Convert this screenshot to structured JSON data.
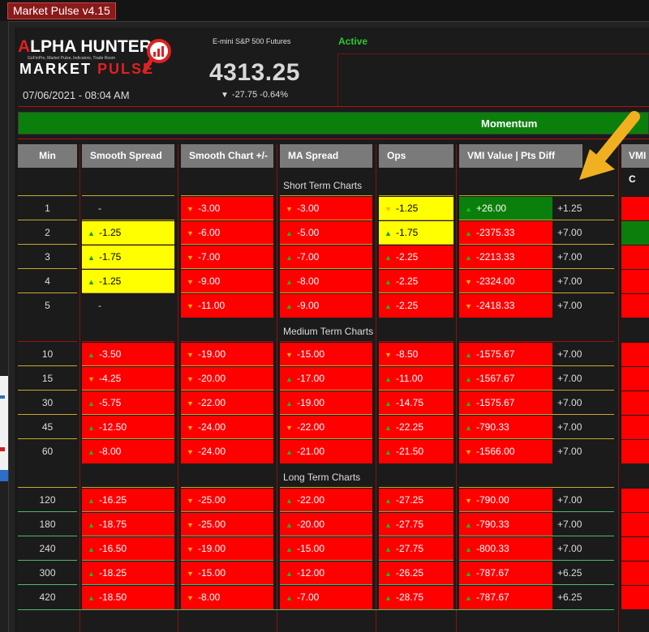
{
  "app": {
    "title": "Market Pulse v4.15"
  },
  "logo": {
    "line1_prefix": "LPHA HUNTERS",
    "line1_initial": "A",
    "tagline": "GoFinPro, Market Pulse, Indicators, Trade Room",
    "line2a": "MARKET ",
    "line2b": "PULSE",
    "icon": "magnifier-chart-icon"
  },
  "header": {
    "datetime": "07/06/2021 - 08:04 AM",
    "instrument": "E-mini S&P 500 Futures",
    "price": "4313.25",
    "change": "-27.75 -0.64%",
    "change_icon": "down-triangle-icon",
    "status": "Active"
  },
  "momentum_label": "Momentum",
  "columns": {
    "min": "Min",
    "smooth_spread": "Smooth Spread",
    "smooth_chart": "Smooth Chart +/-",
    "ma_spread": "MA Spread",
    "ops": "Ops",
    "vmi": "VMI Value | Pts Diff",
    "vmi2": "VMI C"
  },
  "sections": {
    "short": "Short Term Charts",
    "medium": "Medium Term Charts",
    "long": "Long Term Charts"
  },
  "colors": {
    "red": "#ff0000",
    "yellow": "#ffff00",
    "green": "#0b7f0b",
    "arrow": "#f0b020"
  },
  "rows": [
    {
      "min": "1",
      "ss": {
        "v": "-",
        "bg": "plain",
        "arr": ""
      },
      "sc": {
        "v": "-3.00",
        "bg": "red",
        "arr": "down"
      },
      "ma": {
        "v": "-3.00",
        "bg": "red",
        "arr": "down"
      },
      "ops": {
        "v": "-1.25",
        "bg": "yellow",
        "arr": "down"
      },
      "vmi": {
        "v": "+26.00",
        "bg": "green",
        "arr": "up"
      },
      "diff": "+1.25",
      "vmi2": "red"
    },
    {
      "min": "2",
      "ss": {
        "v": "-1.25",
        "bg": "yellow",
        "arr": "up"
      },
      "sc": {
        "v": "-6.00",
        "bg": "red",
        "arr": "down"
      },
      "ma": {
        "v": "-5.00",
        "bg": "red",
        "arr": "up"
      },
      "ops": {
        "v": "-1.75",
        "bg": "yellow",
        "arr": "up"
      },
      "vmi": {
        "v": "-2375.33",
        "bg": "red",
        "arr": "up"
      },
      "diff": "+7.00",
      "vmi2": "green"
    },
    {
      "min": "3",
      "ss": {
        "v": "-1.75",
        "bg": "yellow",
        "arr": "up"
      },
      "sc": {
        "v": "-7.00",
        "bg": "red",
        "arr": "down"
      },
      "ma": {
        "v": "-7.00",
        "bg": "red",
        "arr": "up"
      },
      "ops": {
        "v": "-2.25",
        "bg": "red",
        "arr": "up"
      },
      "vmi": {
        "v": "-2213.33",
        "bg": "red",
        "arr": "up"
      },
      "diff": "+7.00",
      "vmi2": "red"
    },
    {
      "min": "4",
      "ss": {
        "v": "-1.25",
        "bg": "yellow",
        "arr": "up"
      },
      "sc": {
        "v": "-9.00",
        "bg": "red",
        "arr": "down"
      },
      "ma": {
        "v": "-8.00",
        "bg": "red",
        "arr": "up"
      },
      "ops": {
        "v": "-2.25",
        "bg": "red",
        "arr": "up"
      },
      "vmi": {
        "v": "-2324.00",
        "bg": "red",
        "arr": "down"
      },
      "diff": "+7.00",
      "vmi2": "red"
    },
    {
      "min": "5",
      "ss": {
        "v": "-",
        "bg": "plain",
        "arr": ""
      },
      "sc": {
        "v": "-11.00",
        "bg": "red",
        "arr": "down"
      },
      "ma": {
        "v": "-9.00",
        "bg": "red",
        "arr": "up"
      },
      "ops": {
        "v": "-2.25",
        "bg": "red",
        "arr": "up"
      },
      "vmi": {
        "v": "-2418.33",
        "bg": "red",
        "arr": "down"
      },
      "diff": "+7.00",
      "vmi2": "red"
    },
    {
      "min": "10",
      "ss": {
        "v": "-3.50",
        "bg": "red",
        "arr": "up"
      },
      "sc": {
        "v": "-19.00",
        "bg": "red",
        "arr": "down"
      },
      "ma": {
        "v": "-15.00",
        "bg": "red",
        "arr": "down"
      },
      "ops": {
        "v": "-8.50",
        "bg": "red",
        "arr": "down"
      },
      "vmi": {
        "v": "-1575.67",
        "bg": "red",
        "arr": "up"
      },
      "diff": "+7.00",
      "vmi2": "red"
    },
    {
      "min": "15",
      "ss": {
        "v": "-4.25",
        "bg": "red",
        "arr": "down"
      },
      "sc": {
        "v": "-20.00",
        "bg": "red",
        "arr": "down"
      },
      "ma": {
        "v": "-17.00",
        "bg": "red",
        "arr": "up"
      },
      "ops": {
        "v": "-11.00",
        "bg": "red",
        "arr": "up"
      },
      "vmi": {
        "v": "-1567.67",
        "bg": "red",
        "arr": "up"
      },
      "diff": "+7.00",
      "vmi2": "red"
    },
    {
      "min": "30",
      "ss": {
        "v": "-5.75",
        "bg": "red",
        "arr": "up"
      },
      "sc": {
        "v": "-22.00",
        "bg": "red",
        "arr": "down"
      },
      "ma": {
        "v": "-19.00",
        "bg": "red",
        "arr": "up"
      },
      "ops": {
        "v": "-14.75",
        "bg": "red",
        "arr": "up"
      },
      "vmi": {
        "v": "-1575.67",
        "bg": "red",
        "arr": "up"
      },
      "diff": "+7.00",
      "vmi2": "red"
    },
    {
      "min": "45",
      "ss": {
        "v": "-12.50",
        "bg": "red",
        "arr": "up"
      },
      "sc": {
        "v": "-24.00",
        "bg": "red",
        "arr": "down"
      },
      "ma": {
        "v": "-22.00",
        "bg": "red",
        "arr": "down"
      },
      "ops": {
        "v": "-22.25",
        "bg": "red",
        "arr": "up"
      },
      "vmi": {
        "v": "-790.33",
        "bg": "red",
        "arr": "up"
      },
      "diff": "+7.00",
      "vmi2": "red"
    },
    {
      "min": "60",
      "ss": {
        "v": "-8.00",
        "bg": "red",
        "arr": "up"
      },
      "sc": {
        "v": "-24.00",
        "bg": "red",
        "arr": "down"
      },
      "ma": {
        "v": "-21.00",
        "bg": "red",
        "arr": "up"
      },
      "ops": {
        "v": "-21.50",
        "bg": "red",
        "arr": "up"
      },
      "vmi": {
        "v": "-1566.00",
        "bg": "red",
        "arr": "down"
      },
      "diff": "+7.00",
      "vmi2": "red"
    },
    {
      "min": "120",
      "ss": {
        "v": "-16.25",
        "bg": "red",
        "arr": "up"
      },
      "sc": {
        "v": "-25.00",
        "bg": "red",
        "arr": "down"
      },
      "ma": {
        "v": "-22.00",
        "bg": "red",
        "arr": "up"
      },
      "ops": {
        "v": "-27.25",
        "bg": "red",
        "arr": "up"
      },
      "vmi": {
        "v": "-790.00",
        "bg": "red",
        "arr": "down"
      },
      "diff": "+7.00",
      "vmi2": "red"
    },
    {
      "min": "180",
      "ss": {
        "v": "-18.75",
        "bg": "red",
        "arr": "up"
      },
      "sc": {
        "v": "-25.00",
        "bg": "red",
        "arr": "down"
      },
      "ma": {
        "v": "-20.00",
        "bg": "red",
        "arr": "up"
      },
      "ops": {
        "v": "-27.75",
        "bg": "red",
        "arr": "up"
      },
      "vmi": {
        "v": "-790.33",
        "bg": "red",
        "arr": "up"
      },
      "diff": "+7.00",
      "vmi2": "red"
    },
    {
      "min": "240",
      "ss": {
        "v": "-16.50",
        "bg": "red",
        "arr": "up"
      },
      "sc": {
        "v": "-19.00",
        "bg": "red",
        "arr": "down"
      },
      "ma": {
        "v": "-15.00",
        "bg": "red",
        "arr": "up"
      },
      "ops": {
        "v": "-27.75",
        "bg": "red",
        "arr": "up"
      },
      "vmi": {
        "v": "-800.33",
        "bg": "red",
        "arr": "up"
      },
      "diff": "+7.00",
      "vmi2": "red"
    },
    {
      "min": "300",
      "ss": {
        "v": "-18.25",
        "bg": "red",
        "arr": "up"
      },
      "sc": {
        "v": "-15.00",
        "bg": "red",
        "arr": "down"
      },
      "ma": {
        "v": "-12.00",
        "bg": "red",
        "arr": "up"
      },
      "ops": {
        "v": "-26.25",
        "bg": "red",
        "arr": "up"
      },
      "vmi": {
        "v": "-787.67",
        "bg": "red",
        "arr": "up"
      },
      "diff": "+6.25",
      "vmi2": "red"
    },
    {
      "min": "420",
      "ss": {
        "v": "-18.50",
        "bg": "red",
        "arr": "up"
      },
      "sc": {
        "v": "-8.00",
        "bg": "red",
        "arr": "down"
      },
      "ma": {
        "v": "-7.00",
        "bg": "red",
        "arr": "up"
      },
      "ops": {
        "v": "-28.75",
        "bg": "red",
        "arr": "up"
      },
      "vmi": {
        "v": "-787.67",
        "bg": "red",
        "arr": "up"
      },
      "diff": "+6.25",
      "vmi2": "red"
    }
  ],
  "annotation": {
    "icon": "yellow-arrow-annotation-icon"
  }
}
